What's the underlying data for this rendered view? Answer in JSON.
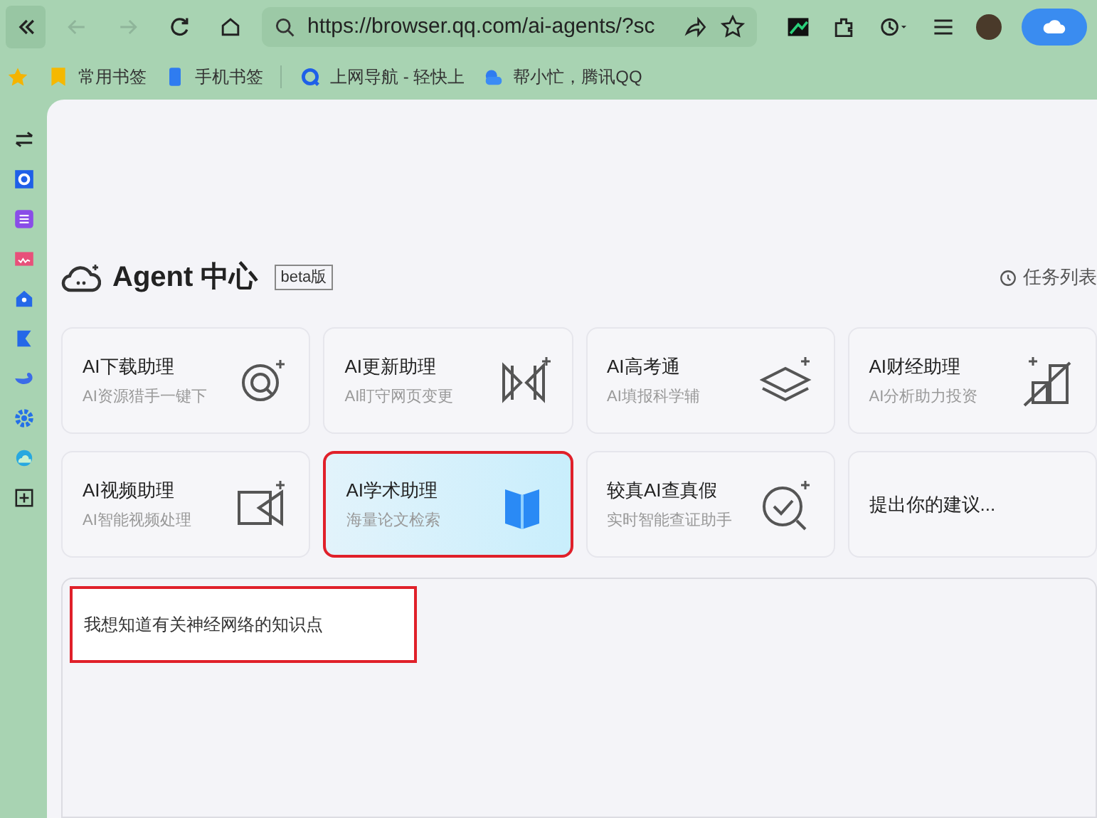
{
  "toolbar": {
    "buttons": [
      {
        "kind": "collapse",
        "disabled": false
      },
      {
        "kind": "back",
        "disabled": true
      },
      {
        "kind": "forward",
        "disabled": true
      },
      {
        "kind": "reload",
        "disabled": false
      },
      {
        "kind": "home",
        "disabled": false
      }
    ],
    "address": {
      "value": "https://browser.qq.com/ai-agents/?sc"
    }
  },
  "bookmarks": [
    {
      "label": "常用书签",
      "kind": "folder"
    },
    {
      "label": "手机书签",
      "kind": "phone"
    },
    {
      "label": "上网导航 - 轻快上",
      "kind": "nav"
    },
    {
      "label": "帮小忙，腾讯QQ",
      "kind": "cloud"
    }
  ],
  "sidebar": {
    "items": [
      {
        "kind": "swap"
      },
      {
        "kind": "q",
        "color": "#1f5fe8"
      },
      {
        "kind": "translate",
        "color": "#8a4de8"
      },
      {
        "kind": "video",
        "color": "#e8507a"
      },
      {
        "kind": "house",
        "color": "#2468e8"
      },
      {
        "kind": "flag",
        "color": "#2468e8"
      },
      {
        "kind": "whale",
        "color": "#3b6ce8"
      },
      {
        "kind": "gear",
        "color": "#2470e8"
      },
      {
        "kind": "cloud",
        "color": "#27a8e0"
      },
      {
        "kind": "add"
      }
    ]
  },
  "header": {
    "title": "Agent 中心",
    "badge": "beta版",
    "task_list": "任务列表"
  },
  "cards": [
    {
      "kind": "assistant",
      "title": "AI下载助理",
      "subtitle": "AI资源猎手一键下",
      "selected": false
    },
    {
      "kind": "assistant",
      "title": "AI更新助理",
      "subtitle": "AI盯守网页变更",
      "selected": false
    },
    {
      "kind": "assistant",
      "title": "AI高考通",
      "subtitle": "AI填报科学辅",
      "selected": false
    },
    {
      "kind": "assistant",
      "title": "AI财经助理",
      "subtitle": "AI分析助力投资",
      "selected": false
    },
    {
      "kind": "assistant",
      "title": "AI视频助理",
      "subtitle": "AI智能视频处理",
      "selected": false
    },
    {
      "kind": "assistant",
      "title": "AI学术助理",
      "subtitle": "海量论文检索",
      "selected": true
    },
    {
      "kind": "assistant",
      "title": "较真AI查真假",
      "subtitle": "实时智能查证助手",
      "selected": false
    },
    {
      "kind": "suggestion",
      "title": "提出你的建议..."
    }
  ],
  "prompt": {
    "value": "我想知道有关神经网络的知识点"
  }
}
